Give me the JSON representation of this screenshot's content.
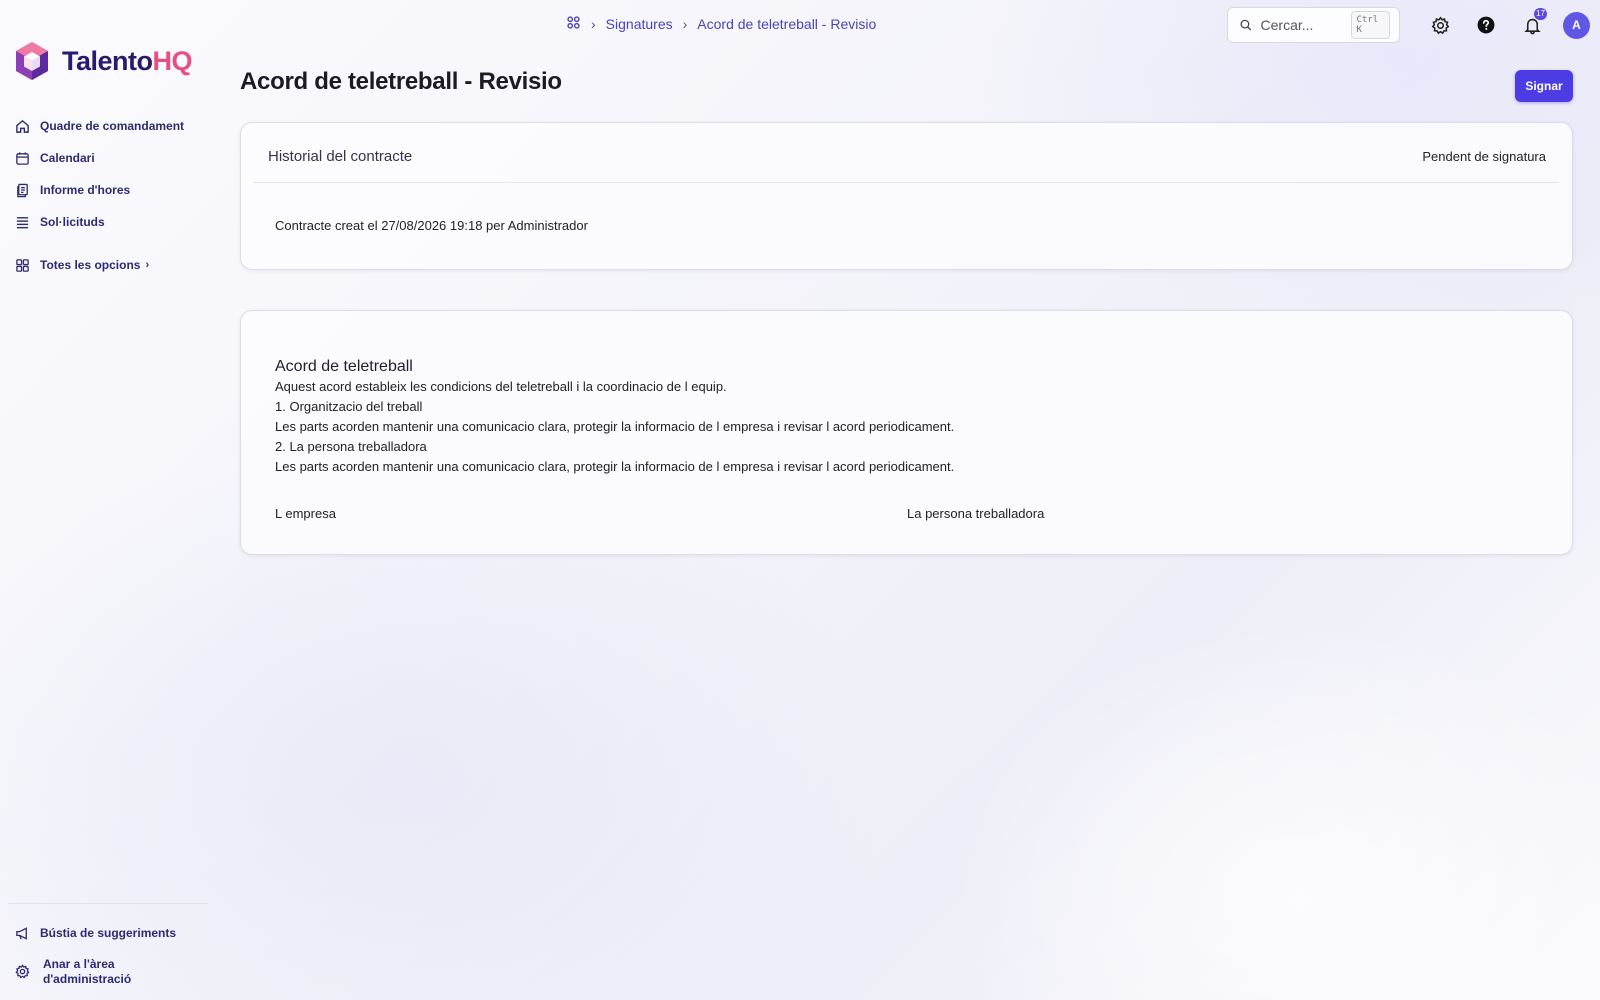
{
  "app": {
    "name_part1": "Talento",
    "name_part2": "HQ"
  },
  "sidebar": {
    "items": [
      {
        "label": "Quadre de comandament",
        "icon": "home-icon"
      },
      {
        "label": "Calendari",
        "icon": "calendar-icon"
      },
      {
        "label": "Informe d'hores",
        "icon": "report-icon"
      },
      {
        "label": "Sol·licituds",
        "icon": "list-icon"
      }
    ],
    "all_options": {
      "label": "Totes les opcions",
      "icon": "grid-icon"
    },
    "bottom": [
      {
        "label": "Bústia de suggeriments",
        "icon": "megaphone-icon"
      },
      {
        "label": "Anar a l'àrea d'administració",
        "icon": "gear-icon"
      }
    ]
  },
  "header": {
    "breadcrumb": [
      "Signatures",
      "Acord de teletreball - Revisio"
    ],
    "search": {
      "placeholder": "Cercar...",
      "shortcut": "Ctrl K"
    },
    "notifications_count": "17",
    "avatar_initial": "A"
  },
  "main": {
    "title": "Acord de teletreball - Revisio",
    "sign_button": "Signar",
    "history": {
      "title": "Historial del contracte",
      "status": "Pendent de signatura",
      "entry": "Contracte creat el 27/08/2026 19:18 per Administrador"
    },
    "document": {
      "heading": "Acord de teletreball",
      "lines": [
        "Aquest acord estableix les condicions del teletreball i la coordinacio de l equip.",
        "1. Organitzacio del treball",
        "Les parts acorden mantenir una comunicacio clara, protegir la informacio de l empresa i revisar l acord periodicament.",
        "2. La persona treballadora",
        "Les parts acorden mantenir una comunicacio clara, protegir la informacio de l empresa i revisar l acord periodicament."
      ],
      "signature_left": "L empresa",
      "signature_right": "La persona treballadora"
    }
  },
  "colors": {
    "accent": "#4d3ce3",
    "brand_dark": "#2a1a6e",
    "brand_pink": "#e64f84",
    "nav_text": "#2d2a73"
  }
}
